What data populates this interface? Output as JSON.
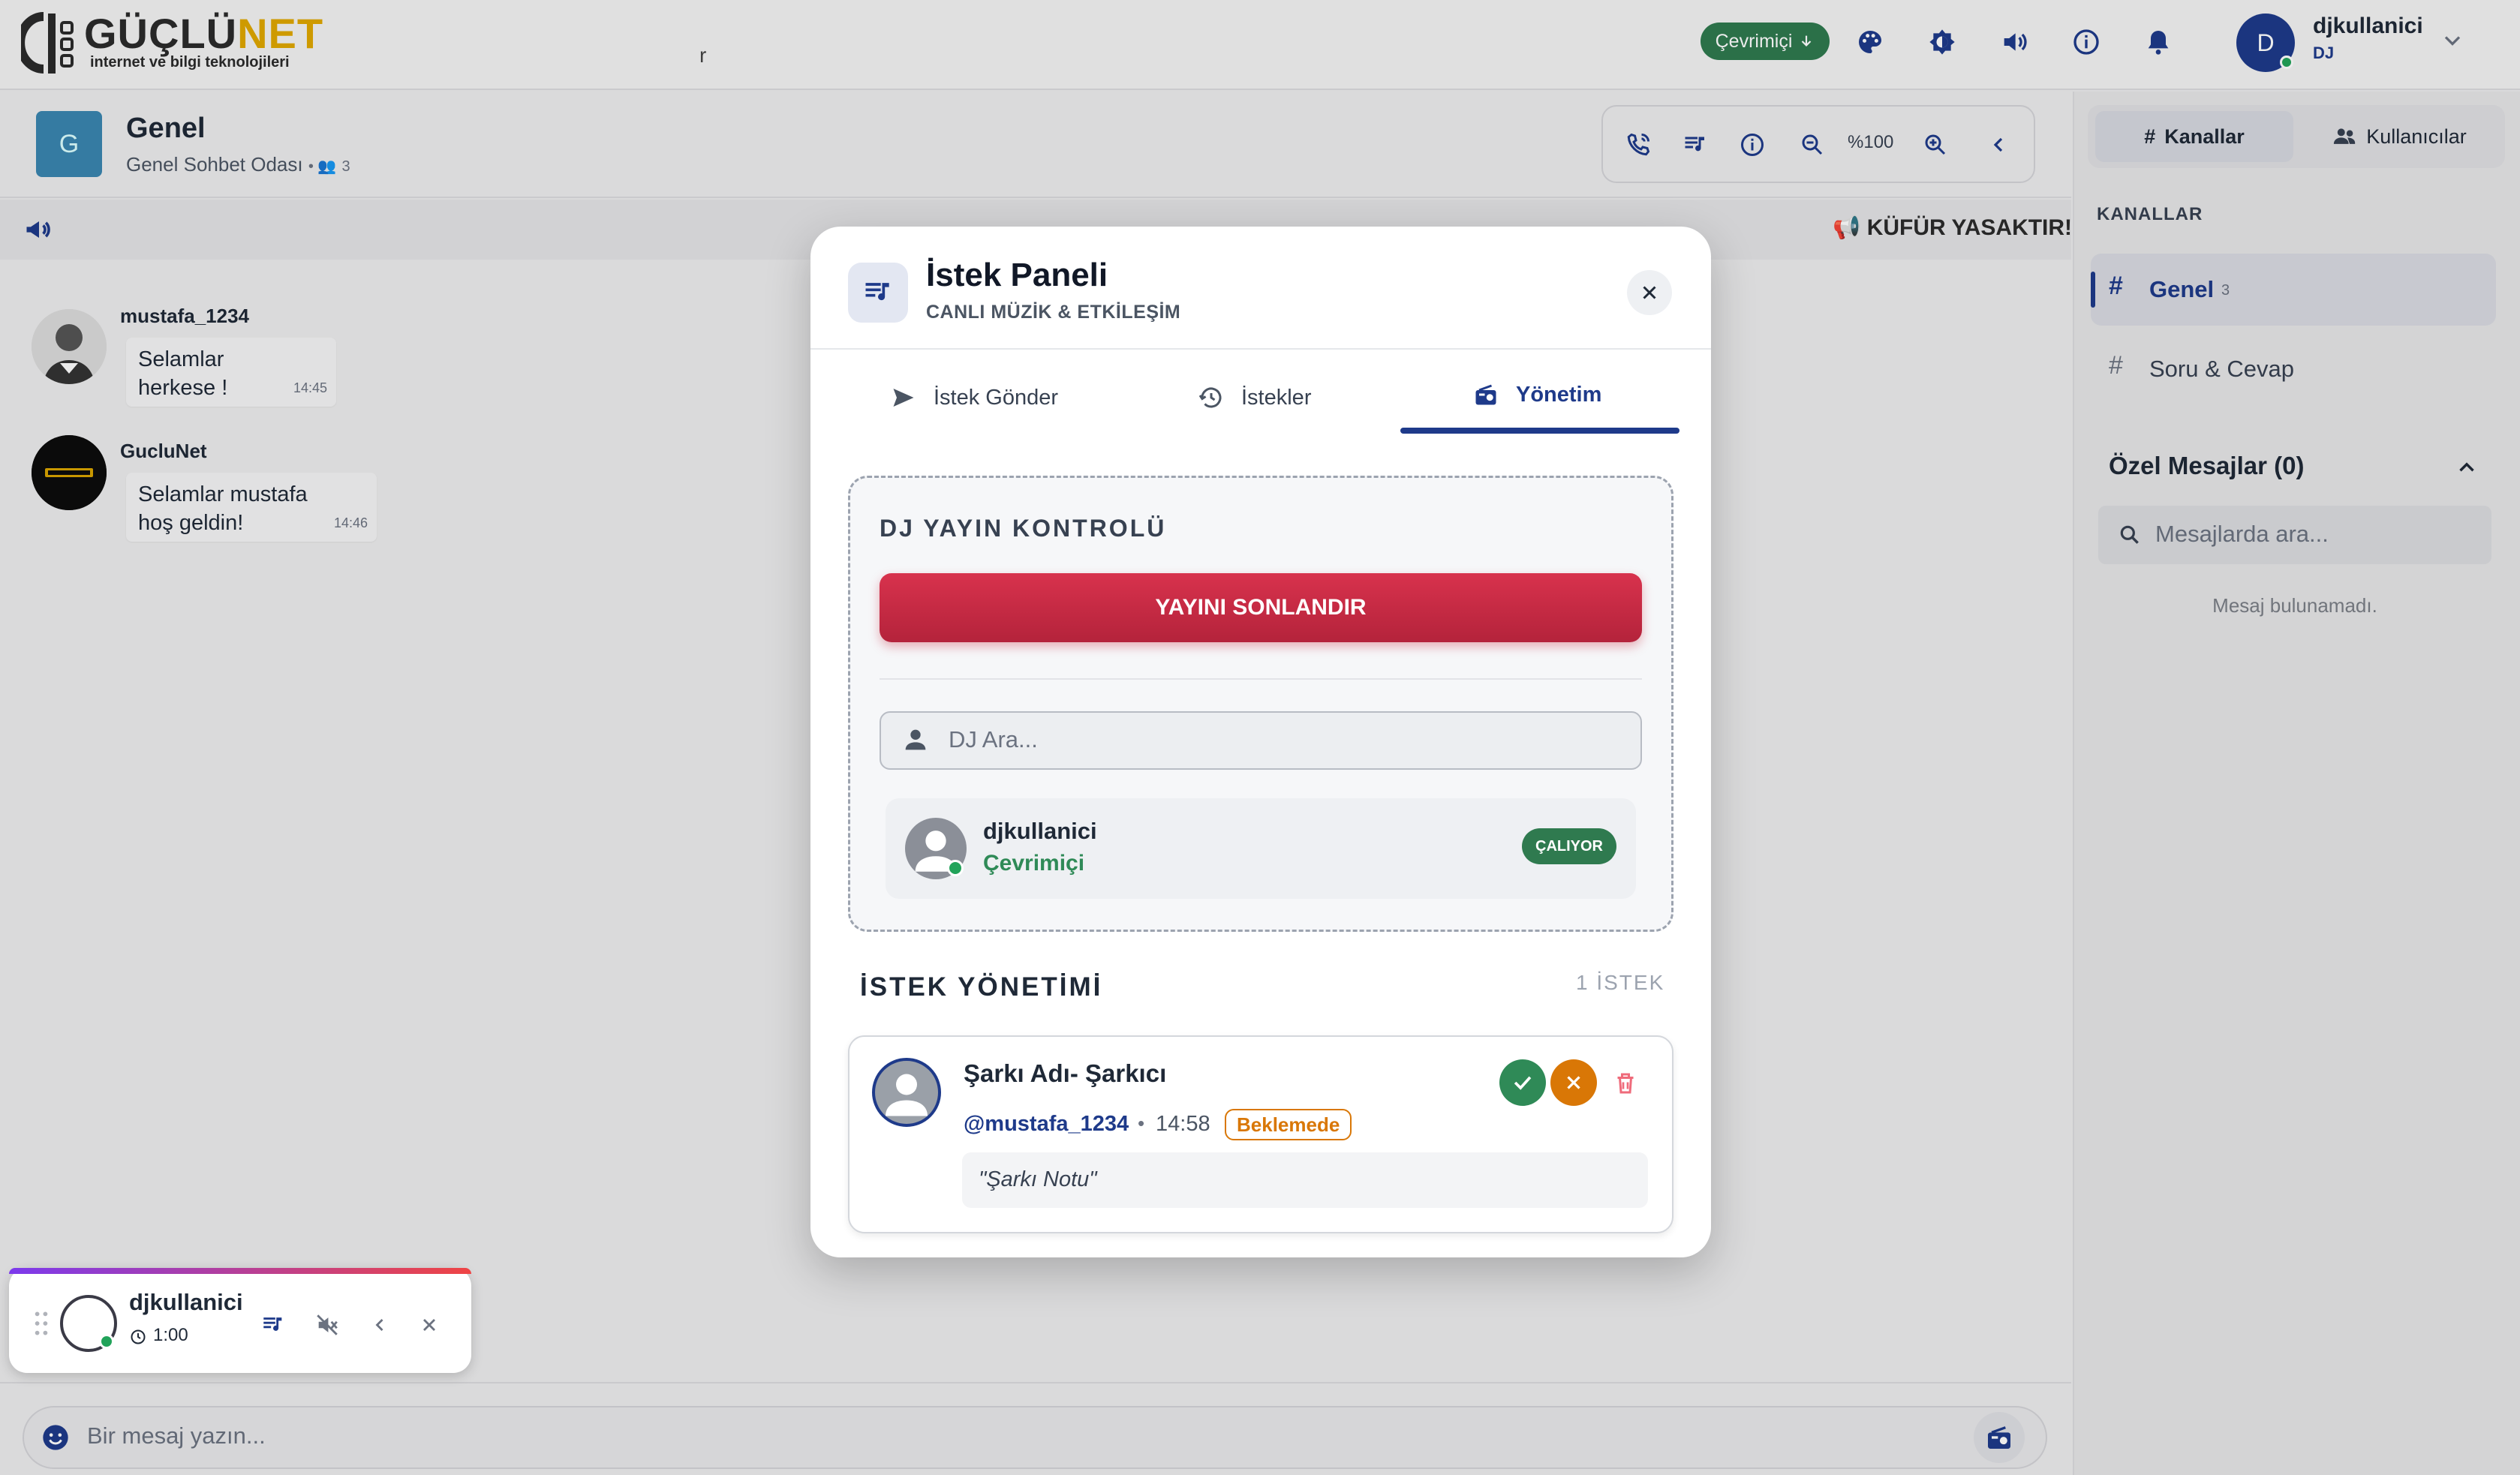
{
  "brand": {
    "name_main": "GÜÇLÜ",
    "name_accent": "NET",
    "tagline": "internet ve bilgi teknolojileri",
    "accent_color": "#e0a800"
  },
  "topbar": {
    "stray_text": "r",
    "status": "Çevrimiçi",
    "icons": [
      "palette-icon",
      "contrast-icon",
      "volume-icon",
      "info-icon",
      "bell-icon"
    ],
    "user": {
      "initial": "D",
      "name": "djkullanici",
      "role": "DJ"
    }
  },
  "room": {
    "initial": "G",
    "title": "Genel",
    "subtitle": "Genel Sohbet Odası",
    "members": "3",
    "zoom": "%100"
  },
  "announcement": {
    "text": "📢 KÜFÜR YASAKTIR!"
  },
  "messages": [
    {
      "author": "mustafa_1234",
      "text_line1": "Selamlar",
      "text_line2": "herkese !",
      "time": "14:45"
    },
    {
      "author": "GucluNet",
      "text_line1": "Selamlar mustafa",
      "text_line2": "hoş geldin!",
      "time": "14:46"
    }
  ],
  "sidebar": {
    "tabs": {
      "channels": "Kanallar",
      "users": "Kullanıcılar"
    },
    "channels_heading": "KANALLAR",
    "channels": [
      {
        "name": "Genel",
        "count": "3"
      },
      {
        "name": "Soru & Cevap"
      }
    ],
    "dm_heading": "Özel Mesajlar (0)",
    "dm_search_placeholder": "Mesajlarda ara...",
    "dm_empty": "Mesaj bulunamadı."
  },
  "composer": {
    "placeholder": "Bir mesaj yazın..."
  },
  "player": {
    "name": "djkullanici",
    "time": "1:00"
  },
  "modal": {
    "title": "İstek Paneli",
    "subtitle": "CANLI MÜZİK & ETKİLEŞİM",
    "tabs": {
      "send": "İstek Gönder",
      "requests": "İstekler",
      "manage": "Yönetim"
    },
    "dj_control_title": "DJ YAYIN KONTROLÜ",
    "end_broadcast": "YAYINI SONLANDIR",
    "dj_search_placeholder": "DJ Ara...",
    "dj": {
      "name": "djkullanici",
      "status": "Çevrimiçi",
      "badge": "ÇALIYOR"
    },
    "requests_title": "İSTEK YÖNETİMİ",
    "requests_count": "1 İSTEK",
    "request": {
      "song": "Şarkı Adı- Şarkıcı",
      "user": "@mustafa_1234",
      "separator": "•",
      "time": "14:58",
      "status": "Beklemede",
      "note": "\"Şarkı Notu\""
    }
  },
  "colors": {
    "primary": "#1e3a8a",
    "danger": "#c62a44",
    "success": "#2f7a4f",
    "warning": "#d97706"
  }
}
